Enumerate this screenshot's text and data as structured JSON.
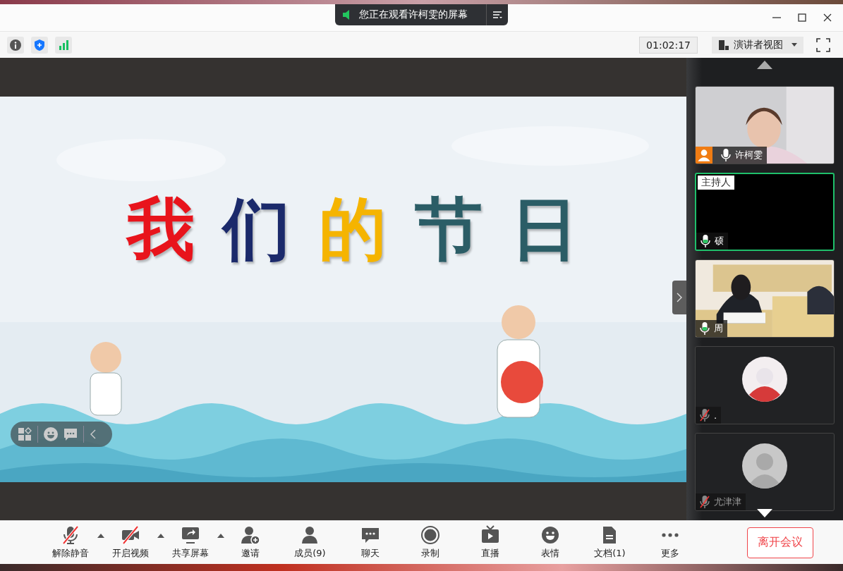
{
  "window": {
    "banner": "您正在观看许柯雯的屏幕"
  },
  "toolbar": {
    "timer": "01:02:17",
    "view_menu": "演讲者视图"
  },
  "slide": {
    "title": [
      {
        "char": "我",
        "color": "#e8141c"
      },
      {
        "char": "们",
        "color": "#1b2a6b"
      },
      {
        "char": "的",
        "color": "#f5b400"
      },
      {
        "char": "节",
        "color": "#2b5d66"
      },
      {
        "char": "日",
        "color": "#2b5d66"
      }
    ]
  },
  "participants": [
    {
      "name": "许柯雯",
      "kind": "video",
      "muted": false,
      "speaking": false,
      "active": false,
      "self": true
    },
    {
      "name": "硕",
      "kind": "black",
      "host_tag": "主持人",
      "muted": false,
      "speaking": true,
      "active": true,
      "self": false
    },
    {
      "name": "周",
      "kind": "video",
      "muted": false,
      "speaking": true,
      "active": false,
      "self": false
    },
    {
      "name": ".",
      "kind": "avatar",
      "muted": true,
      "speaking": false,
      "active": false,
      "self": false
    },
    {
      "name": "尤津津",
      "kind": "default",
      "muted": true,
      "speaking": false,
      "active": false,
      "self": false
    }
  ],
  "controls": [
    {
      "label": "解除静音",
      "kind": "mic",
      "off": true,
      "has_menu": true
    },
    {
      "label": "开启视频",
      "kind": "camera",
      "off": true,
      "has_menu": true
    },
    {
      "label": "共享屏幕",
      "kind": "share",
      "off": false,
      "has_menu": true
    },
    {
      "label": "邀请",
      "kind": "invite",
      "off": false,
      "has_menu": false
    },
    {
      "label": "成员(9)",
      "kind": "members",
      "off": false,
      "has_menu": false
    },
    {
      "label": "聊天",
      "kind": "chat",
      "off": false,
      "has_menu": false
    },
    {
      "label": "录制",
      "kind": "record",
      "off": false,
      "has_menu": false
    },
    {
      "label": "直播",
      "kind": "live",
      "off": false,
      "has_menu": false
    },
    {
      "label": "表情",
      "kind": "emoji",
      "off": false,
      "has_menu": false
    },
    {
      "label": "文档(1)",
      "kind": "document",
      "off": false,
      "has_menu": false
    },
    {
      "label": "更多",
      "kind": "more",
      "off": false,
      "has_menu": false
    }
  ],
  "leave_button": "离开会议"
}
